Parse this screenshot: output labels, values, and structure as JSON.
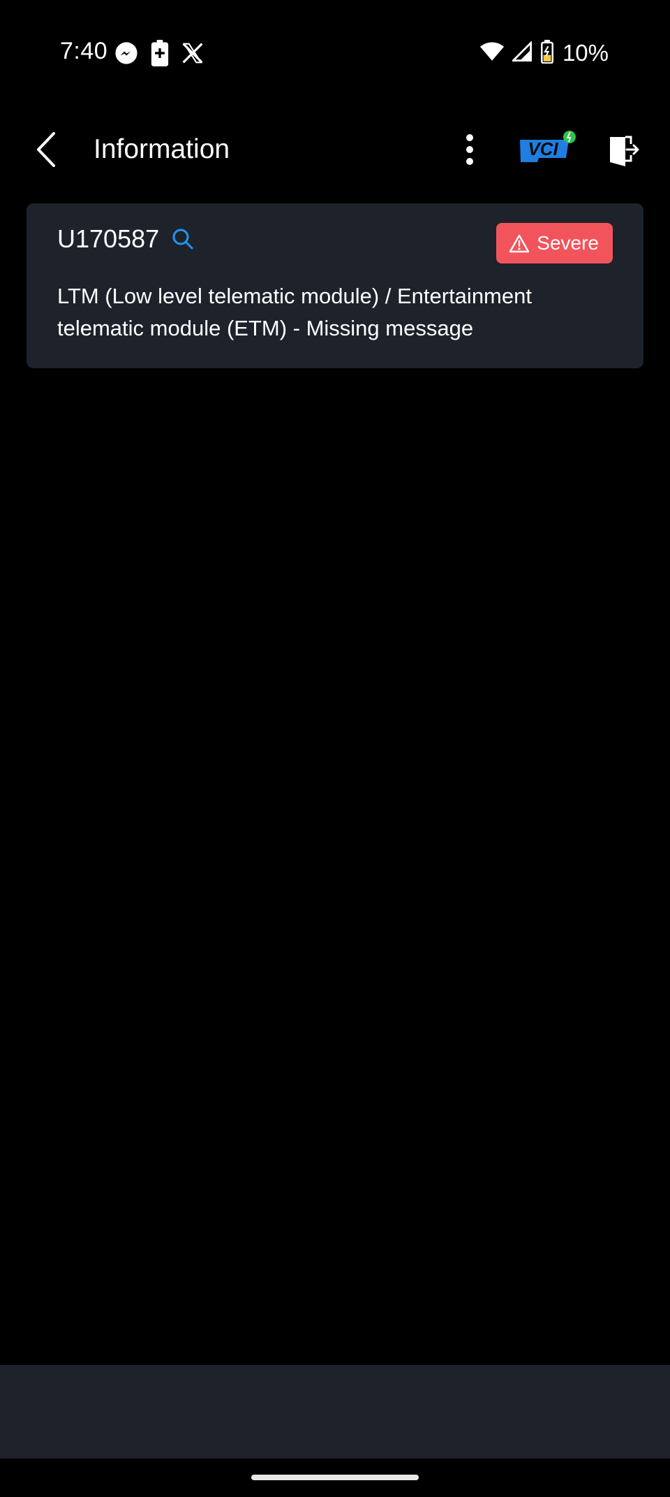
{
  "status_bar": {
    "time": "7:40",
    "battery_percent": "10%",
    "left_icons": [
      "messenger-icon",
      "battery-saver-icon",
      "x-icon"
    ],
    "right_icons": [
      "wifi-icon",
      "signal-icon",
      "battery-charging-icon"
    ]
  },
  "header": {
    "title": "Information",
    "icons": [
      "back-arrow-icon",
      "more-vert-icon",
      "vci-icon",
      "exit-icon"
    ],
    "vci_label": "VCI"
  },
  "dtc": {
    "code": "U170587",
    "severity": "Severe",
    "description": "LTM (Low level telematic module) / Entertainment telematic module (ETM) - Missing message"
  },
  "colors": {
    "background": "#000000",
    "card": "#1e222b",
    "severe": "#f2545b",
    "accent_blue": "#2196f3",
    "vci_green": "#2ec24f"
  }
}
